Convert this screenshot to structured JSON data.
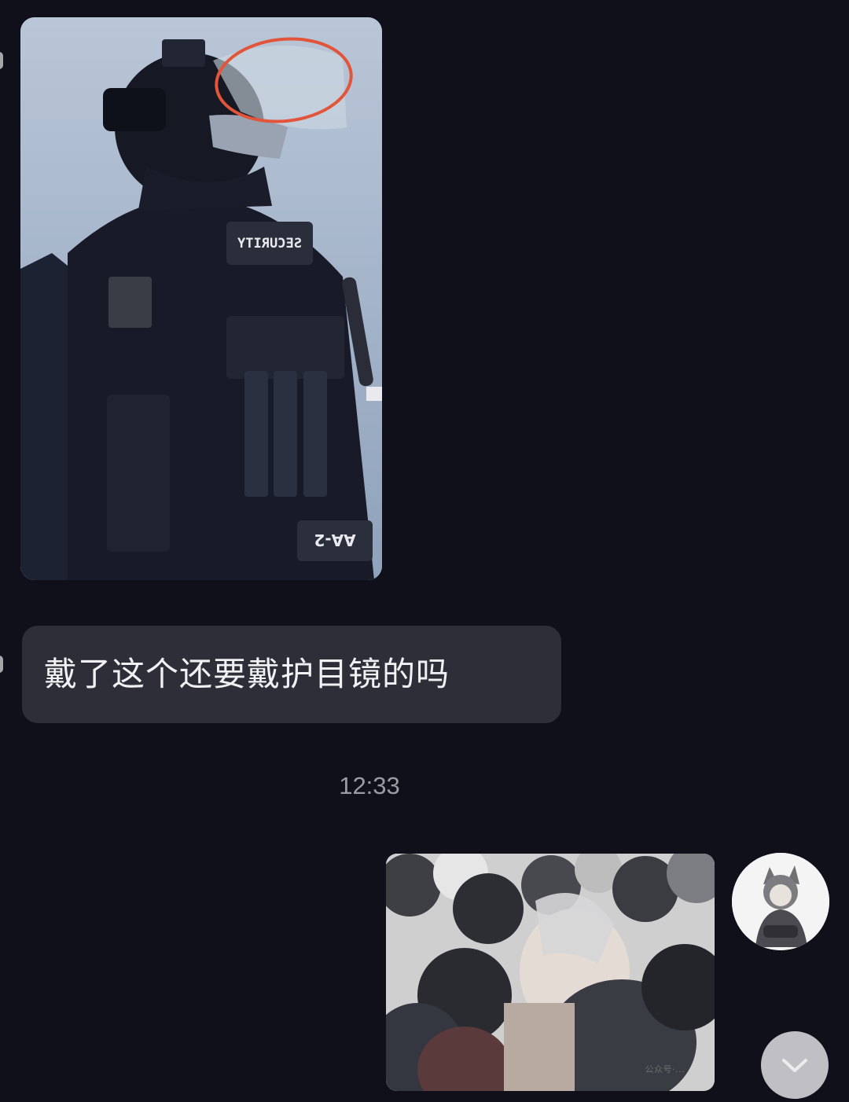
{
  "messages": [
    {
      "kind": "image",
      "side": "left",
      "patches": {
        "chest": "SECURITY",
        "bottom": "AA-2"
      }
    },
    {
      "kind": "text",
      "side": "left",
      "text": "戴了这个还要戴护目镜的吗"
    },
    {
      "kind": "timestamp",
      "text": "12:33"
    },
    {
      "kind": "image",
      "side": "right",
      "watermark": "公众号·..."
    }
  ],
  "colors": {
    "background": "#0f1019",
    "bubble": "#2d2e38",
    "bubble_text": "#f1f1f3",
    "timestamp": "#9a9ba3",
    "annotation_circle": "#e2553a"
  },
  "icons": {
    "scroll_down": "chevron-down-icon",
    "avatar": "user-avatar"
  }
}
